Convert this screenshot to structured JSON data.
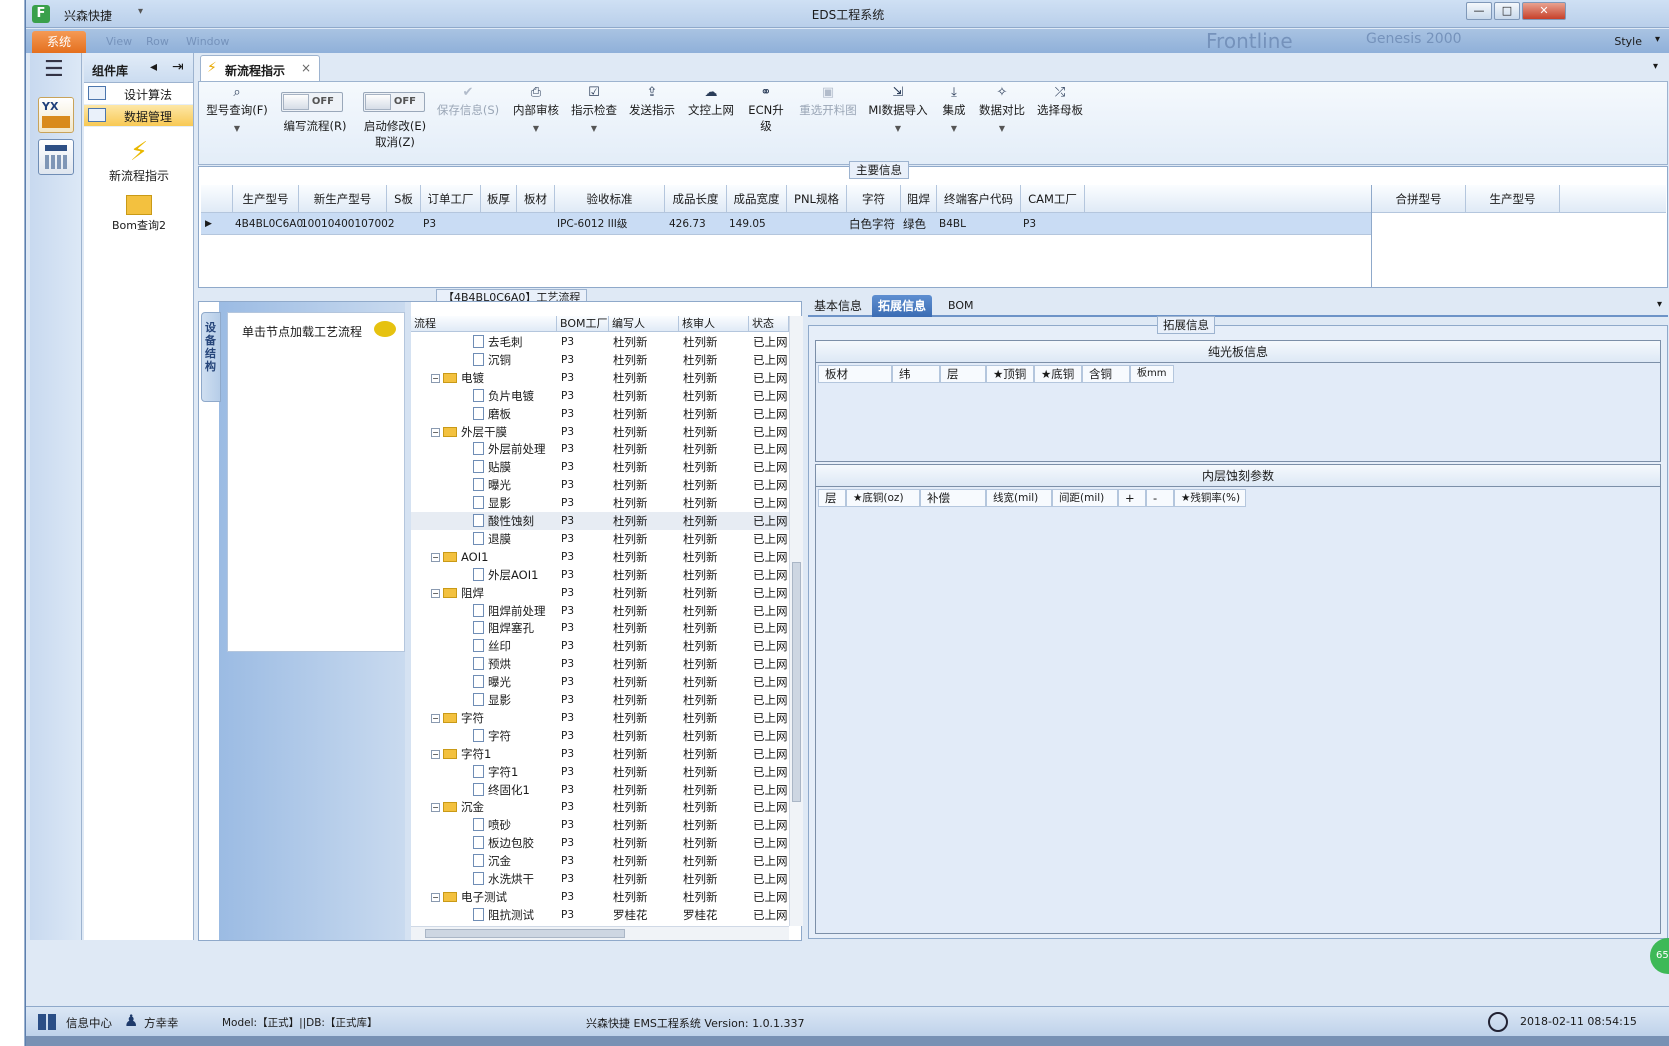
{
  "titlebar": {
    "app_name": "兴森快捷",
    "window_title": "EDS工程系统",
    "minimize": "—",
    "maximize": "□",
    "close": "✕"
  },
  "ribbon": {
    "system_tab": "系统",
    "style_label": "Style",
    "ghost": [
      "View",
      "Row",
      "Window",
      "Frontline",
      "Genesis 2000"
    ]
  },
  "component_panel": {
    "title": "组件库",
    "items": [
      {
        "label": "设计算法"
      },
      {
        "label": "数据管理",
        "selected": true
      }
    ],
    "big_items": [
      {
        "label": "新流程指示",
        "icon": "lightning-icon"
      },
      {
        "label": "Bom查询2",
        "icon": "folder-icon"
      }
    ]
  },
  "doc_tab": {
    "label": "新流程指示",
    "close": "×"
  },
  "toolbar": {
    "buttons": [
      {
        "label": "型号查询(F)",
        "icon": "search-icon",
        "dropdown": true
      },
      {
        "label": "保存信息(S)",
        "icon": "check-icon",
        "disabled": true
      },
      {
        "label": "内部审核",
        "icon": "print-icon",
        "dropdown": true
      },
      {
        "label": "指示检查",
        "icon": "checkbox-icon",
        "dropdown": true
      },
      {
        "label": "发送指示",
        "icon": "upload-icon"
      },
      {
        "label": "文控上网",
        "icon": "cloud-upload-icon"
      },
      {
        "label": "ECN升级",
        "icon": "binoculars-icon"
      },
      {
        "label": "重选开料图",
        "icon": "image-icon",
        "disabled": true
      },
      {
        "label": "MI数据导入",
        "icon": "import-icon",
        "dropdown": true
      },
      {
        "label": "集成",
        "icon": "download-icon",
        "dropdown": true
      },
      {
        "label": "数据对比",
        "icon": "magic-icon",
        "dropdown": true
      },
      {
        "label": "选择母板",
        "icon": "shuffle-icon"
      }
    ],
    "toggles": [
      {
        "state": "OFF",
        "label": "编写流程(R)"
      },
      {
        "state": "OFF",
        "label": "启动修改(E)",
        "label2": "取消(Z)"
      }
    ]
  },
  "main_info": {
    "caption": "主要信息",
    "columns": [
      "生产型号",
      "新生产型号",
      "S板",
      "订单工厂",
      "板厚",
      "板材",
      "验收标准",
      "成品长度",
      "成品宽度",
      "PNL规格",
      "字符",
      "阻焊",
      "终端客户代码",
      "CAM工厂"
    ],
    "row": [
      "4B4BL0C6A0",
      "10010400107002",
      "",
      "P3",
      "",
      "",
      "IPC-6012 III级",
      "426.73",
      "149.05",
      "",
      "白色字符",
      "绿色",
      "B4BL",
      "P3"
    ],
    "side_columns": [
      "合拼型号",
      "生产型号"
    ]
  },
  "flow": {
    "caption": "【4B4BL0C6A0】工艺流程",
    "side_tab": "设备结构",
    "hint": "单击节点加载工艺流程",
    "columns": [
      "流程",
      "BOM工厂",
      "编写人",
      "核审人",
      "状态"
    ],
    "rows": [
      {
        "name": "去毛刺",
        "folder": false,
        "factory": "P3",
        "writer": "杜列新",
        "reviewer": "杜列新",
        "status": "已上网"
      },
      {
        "name": "沉铜",
        "folder": false,
        "factory": "P3",
        "writer": "杜列新",
        "reviewer": "杜列新",
        "status": "已上网"
      },
      {
        "name": "电镀",
        "folder": true,
        "factory": "P3",
        "writer": "杜列新",
        "reviewer": "杜列新",
        "status": "已上网"
      },
      {
        "name": "负片电镀",
        "folder": false,
        "factory": "P3",
        "writer": "杜列新",
        "reviewer": "杜列新",
        "status": "已上网"
      },
      {
        "name": "磨板",
        "folder": false,
        "factory": "P3",
        "writer": "杜列新",
        "reviewer": "杜列新",
        "status": "已上网"
      },
      {
        "name": "外层干膜",
        "folder": true,
        "factory": "P3",
        "writer": "杜列新",
        "reviewer": "杜列新",
        "status": "已上网"
      },
      {
        "name": "外层前处理",
        "folder": false,
        "factory": "P3",
        "writer": "杜列新",
        "reviewer": "杜列新",
        "status": "已上网"
      },
      {
        "name": "贴膜",
        "folder": false,
        "factory": "P3",
        "writer": "杜列新",
        "reviewer": "杜列新",
        "status": "已上网"
      },
      {
        "name": "曝光",
        "folder": false,
        "factory": "P3",
        "writer": "杜列新",
        "reviewer": "杜列新",
        "status": "已上网"
      },
      {
        "name": "显影",
        "folder": false,
        "factory": "P3",
        "writer": "杜列新",
        "reviewer": "杜列新",
        "status": "已上网"
      },
      {
        "name": "酸性蚀刻",
        "folder": false,
        "factory": "P3",
        "writer": "杜列新",
        "reviewer": "杜列新",
        "status": "已上网",
        "selected": true
      },
      {
        "name": "退膜",
        "folder": false,
        "factory": "P3",
        "writer": "杜列新",
        "reviewer": "杜列新",
        "status": "已上网"
      },
      {
        "name": "AOI1",
        "folder": true,
        "factory": "P3",
        "writer": "杜列新",
        "reviewer": "杜列新",
        "status": "已上网"
      },
      {
        "name": "外层AOI1",
        "folder": false,
        "factory": "P3",
        "writer": "杜列新",
        "reviewer": "杜列新",
        "status": "已上网"
      },
      {
        "name": "阻焊",
        "folder": true,
        "factory": "P3",
        "writer": "杜列新",
        "reviewer": "杜列新",
        "status": "已上网"
      },
      {
        "name": "阻焊前处理",
        "folder": false,
        "factory": "P3",
        "writer": "杜列新",
        "reviewer": "杜列新",
        "status": "已上网"
      },
      {
        "name": "阻焊塞孔",
        "folder": false,
        "factory": "P3",
        "writer": "杜列新",
        "reviewer": "杜列新",
        "status": "已上网"
      },
      {
        "name": "丝印",
        "folder": false,
        "factory": "P3",
        "writer": "杜列新",
        "reviewer": "杜列新",
        "status": "已上网"
      },
      {
        "name": "预烘",
        "folder": false,
        "factory": "P3",
        "writer": "杜列新",
        "reviewer": "杜列新",
        "status": "已上网"
      },
      {
        "name": "曝光",
        "folder": false,
        "factory": "P3",
        "writer": "杜列新",
        "reviewer": "杜列新",
        "status": "已上网"
      },
      {
        "name": "显影",
        "folder": false,
        "factory": "P3",
        "writer": "杜列新",
        "reviewer": "杜列新",
        "status": "已上网"
      },
      {
        "name": "字符",
        "folder": true,
        "factory": "P3",
        "writer": "杜列新",
        "reviewer": "杜列新",
        "status": "已上网"
      },
      {
        "name": "字符",
        "folder": false,
        "factory": "P3",
        "writer": "杜列新",
        "reviewer": "杜列新",
        "status": "已上网"
      },
      {
        "name": "字符1",
        "folder": true,
        "factory": "P3",
        "writer": "杜列新",
        "reviewer": "杜列新",
        "status": "已上网"
      },
      {
        "name": "字符1",
        "folder": false,
        "factory": "P3",
        "writer": "杜列新",
        "reviewer": "杜列新",
        "status": "已上网"
      },
      {
        "name": "终固化1",
        "folder": false,
        "factory": "P3",
        "writer": "杜列新",
        "reviewer": "杜列新",
        "status": "已上网"
      },
      {
        "name": "沉金",
        "folder": true,
        "factory": "P3",
        "writer": "杜列新",
        "reviewer": "杜列新",
        "status": "已上网"
      },
      {
        "name": "喷砂",
        "folder": false,
        "factory": "P3",
        "writer": "杜列新",
        "reviewer": "杜列新",
        "status": "已上网"
      },
      {
        "name": "板边包胶",
        "folder": false,
        "factory": "P3",
        "writer": "杜列新",
        "reviewer": "杜列新",
        "status": "已上网"
      },
      {
        "name": "沉金",
        "folder": false,
        "factory": "P3",
        "writer": "杜列新",
        "reviewer": "杜列新",
        "status": "已上网"
      },
      {
        "name": "水洗烘干",
        "folder": false,
        "factory": "P3",
        "writer": "杜列新",
        "reviewer": "杜列新",
        "status": "已上网"
      },
      {
        "name": "电子测试",
        "folder": true,
        "factory": "P3",
        "writer": "杜列新",
        "reviewer": "杜列新",
        "status": "已上网"
      },
      {
        "name": "阻抗测试",
        "folder": false,
        "factory": "P3",
        "writer": "罗桂花",
        "reviewer": "罗桂花",
        "status": "已上网"
      }
    ]
  },
  "right_panel": {
    "tabs": [
      {
        "label": "基本信息"
      },
      {
        "label": "拓展信息",
        "active": true
      },
      {
        "label": "BOM"
      }
    ],
    "ext_caption": "拓展信息",
    "bare_board": {
      "title": "纯光板信息",
      "columns": [
        "板材",
        "纬",
        "层",
        "★顶铜",
        "★底铜",
        "含铜",
        "板mm"
      ]
    },
    "inner_etch": {
      "title": "内层蚀刻参数",
      "columns": [
        "层",
        "★底铜(oz)",
        "补偿",
        "线宽(mil)",
        "间距(mil)",
        "+",
        "-",
        "★残铜率(%)"
      ]
    }
  },
  "statusbar": {
    "info_center": "信息中心",
    "user": "方幸幸",
    "model": "Model:【正式】||DB:【正式库】",
    "version": "兴森快捷 EMS工程系统 Version: 1.0.1.337",
    "datetime": "2018-02-11 08:54:15"
  },
  "floating_badge": "65"
}
